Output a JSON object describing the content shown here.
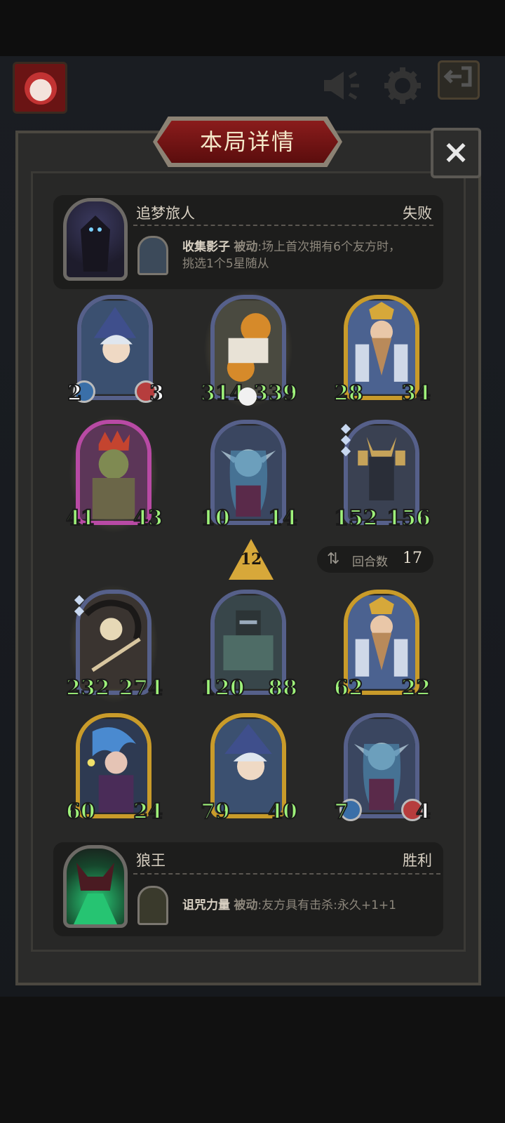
{
  "title": "本局详情",
  "close_icon": "×",
  "top_player": {
    "name": "追梦旅人",
    "result": "失败",
    "skill_name": "收集影子",
    "skill_type": "被动",
    "skill_desc_1": ":场上首次拥有6个友方时，",
    "skill_desc_2": "挑选1个5星随从"
  },
  "bottom_player": {
    "name": "狼王",
    "result": "胜利",
    "skill_name": "诅咒力量",
    "skill_type": "被动",
    "skill_desc_1": ":友方具有击杀:永久+1+1"
  },
  "tier": "12",
  "rounds": {
    "label": "回合数",
    "value": "17"
  },
  "opponent_units": [
    {
      "atk": "2",
      "hp": "3"
    },
    {
      "atk": "314",
      "hp": "339"
    },
    {
      "atk": "28",
      "hp": "34"
    },
    {
      "atk": "41",
      "hp": "43"
    },
    {
      "atk": "10",
      "hp": "14"
    },
    {
      "atk": "152",
      "hp": "156"
    }
  ],
  "player_units": [
    {
      "atk": "232",
      "hp": "274"
    },
    {
      "atk": "120",
      "hp": "88"
    },
    {
      "atk": "62",
      "hp": "22"
    },
    {
      "atk": "60",
      "hp": "24"
    },
    {
      "atk": "79",
      "hp": "40"
    },
    {
      "atk": "7",
      "hp": "4"
    }
  ],
  "colors": {
    "stat_green": "#9ef27a",
    "title_red": "#8a1c1c",
    "gold_frame": "#c99b2a"
  },
  "icons": [
    "avatar",
    "megaphone-icon",
    "gear-icon",
    "exit-icon",
    "close-icon",
    "skull-icon",
    "rounds-icon"
  ]
}
